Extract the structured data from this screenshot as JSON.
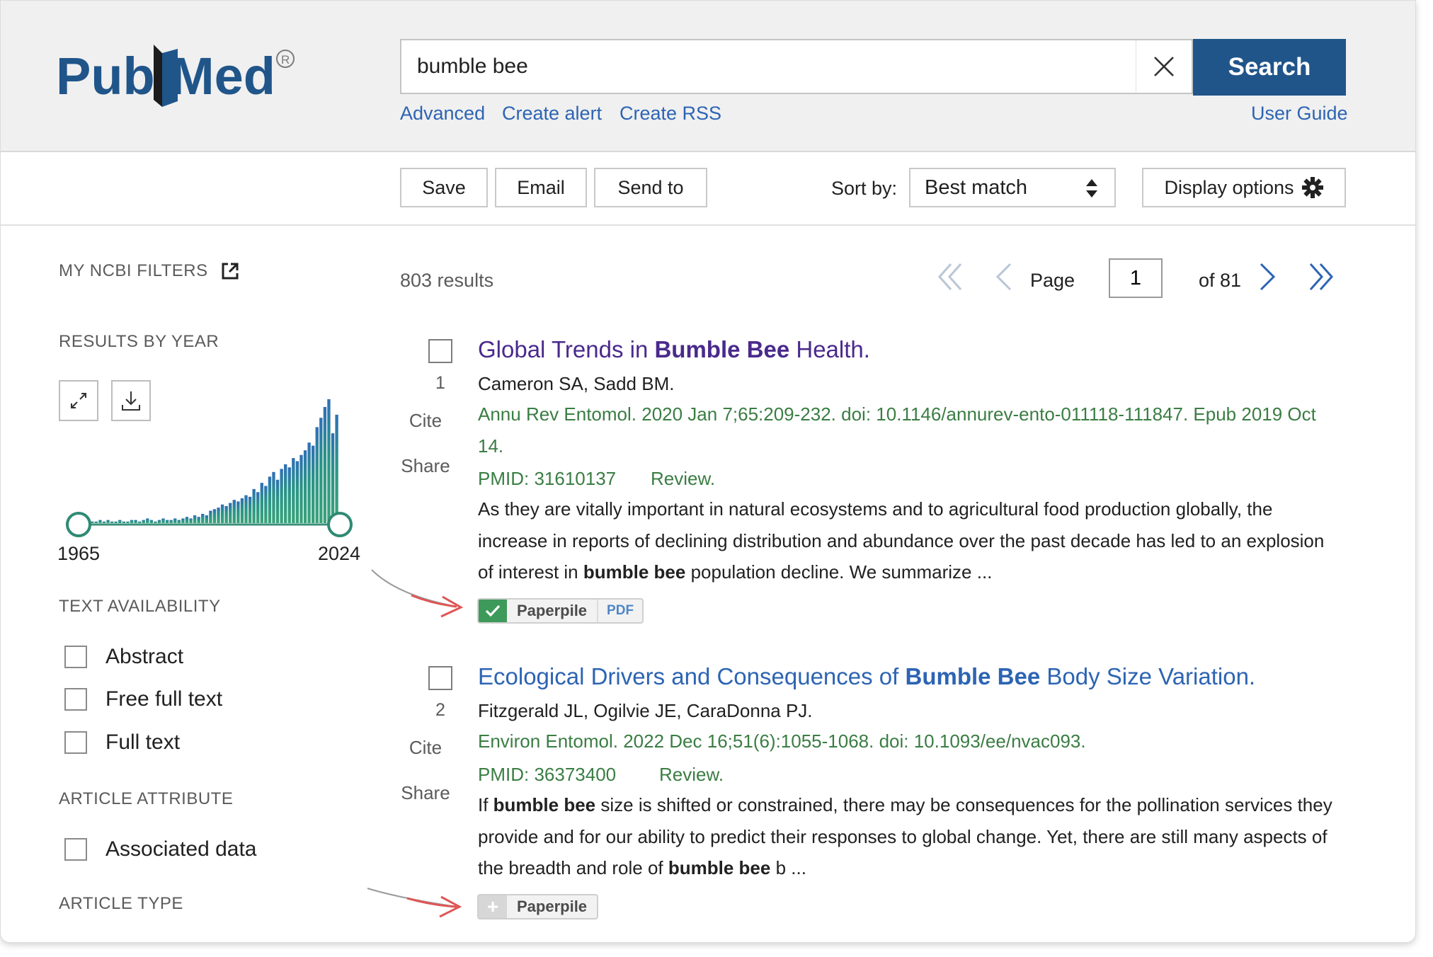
{
  "header": {
    "logo_text": "PubMed",
    "search_value": "bumble bee",
    "search_button": "Search",
    "links": {
      "advanced": "Advanced",
      "create_alert": "Create alert",
      "create_rss": "Create RSS",
      "user_guide": "User Guide"
    }
  },
  "toolbar": {
    "save": "Save",
    "email": "Email",
    "send_to": "Send to",
    "sort_label": "Sort by:",
    "sort_value": "Best match",
    "display_options": "Display options"
  },
  "sidebar": {
    "my_ncbi_filters": "MY NCBI FILTERS",
    "results_by_year": "RESULTS BY YEAR",
    "year_start": "1965",
    "year_end": "2024",
    "text_availability": "TEXT AVAILABILITY",
    "text_filters": [
      "Abstract",
      "Free full text",
      "Full text"
    ],
    "article_attribute": "ARTICLE ATTRIBUTE",
    "attribute_filters": [
      "Associated data"
    ],
    "article_type": "ARTICLE TYPE"
  },
  "histogram": {
    "counts": [
      1,
      2,
      1,
      1,
      2,
      1,
      2,
      1,
      1,
      2,
      1,
      1,
      2,
      2,
      1,
      2,
      3,
      2,
      1,
      2,
      3,
      2,
      2,
      3,
      2,
      3,
      4,
      3,
      5,
      4,
      6,
      5,
      8,
      9,
      10,
      12,
      11,
      13,
      15,
      14,
      16,
      18,
      17,
      22,
      20,
      26,
      24,
      30,
      33,
      28,
      35,
      38,
      36,
      42,
      40,
      44,
      47,
      52,
      50,
      62,
      68,
      75,
      80,
      58,
      70
    ]
  },
  "results": {
    "count": "803 results",
    "page_label": "Page",
    "page_value": "1",
    "page_total": "of 81",
    "items": [
      {
        "number": "1",
        "title_pre": "Global Trends in ",
        "title_bold": "Bumble Bee",
        "title_post": " Health.",
        "authors": "Cameron SA, Sadd BM.",
        "citation": "Annu Rev Entomol. 2020 Jan 7;65:209-232. doi: 10.1146/annurev-ento-011118-111847. Epub 2019 Oct 14.",
        "pmid": "PMID: 31610137",
        "type": "Review.",
        "snippet_1": "As they are vitally important in natural ecosystems and to agricultural food production globally, the increase in reports of declining distribution and abundance over the past decade has led to an explosion of interest in ",
        "snippet_bold": "bumble bee",
        "snippet_2": " population decline. We summarize ...",
        "cite": "Cite",
        "share": "Share",
        "paperpile": "Paperpile",
        "pdf": "PDF"
      },
      {
        "number": "2",
        "title_pre": "Ecological Drivers and Consequences of ",
        "title_bold": "Bumble Bee",
        "title_post": " Body Size Variation.",
        "authors": "Fitzgerald JL, Ogilvie JE, CaraDonna PJ.",
        "citation": "Environ Entomol. 2022 Dec 16;51(6):1055-1068. doi: 10.1093/ee/nvac093.",
        "pmid": "PMID: 36373400",
        "type": "Review.",
        "snippet_a": "If ",
        "snippet_bold_a": "bumble bee",
        "snippet_b": " size is shifted or constrained, there may be consequences for the pollination services they provide and for our ability to predict their responses to global change. Yet, there are still many aspects of the breadth and role of ",
        "snippet_bold_b": "bumble bee",
        "snippet_c": " b ...",
        "cite": "Cite",
        "share": "Share",
        "paperpile": "Paperpile"
      }
    ]
  },
  "colors": {
    "brand_blue": "#20558a",
    "link_blue": "#2d64b3",
    "visited": "#4a2a8c",
    "citation_green": "#3a7d43",
    "arrow_red": "#e05555"
  }
}
